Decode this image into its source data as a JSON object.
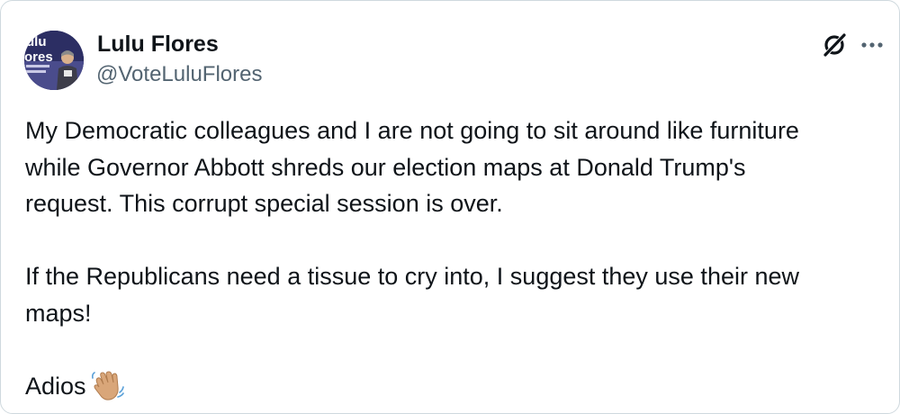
{
  "author": {
    "name": "Lulu Flores",
    "handle": "@VoteLuluFlores",
    "avatar_sign_text": "Lulu\nores"
  },
  "actions": {
    "grok_icon": "grok-icon",
    "more_icon": "more-options-icon"
  },
  "post": {
    "paragraphs": [
      "My Democratic colleagues and I are not going to sit around like furniture\nwhile Governor Abbott shreds our election maps at Donald Trump's\nrequest. This corrupt special session is over.",
      "If the Republicans need a tissue to cry into, I suggest they use their new\nmaps!"
    ],
    "closing": "Adios",
    "closing_emoji": "waving-hand-emoji"
  },
  "colors": {
    "text": "#0f1419",
    "secondary_text": "#536471",
    "border": "#cfd9de"
  }
}
